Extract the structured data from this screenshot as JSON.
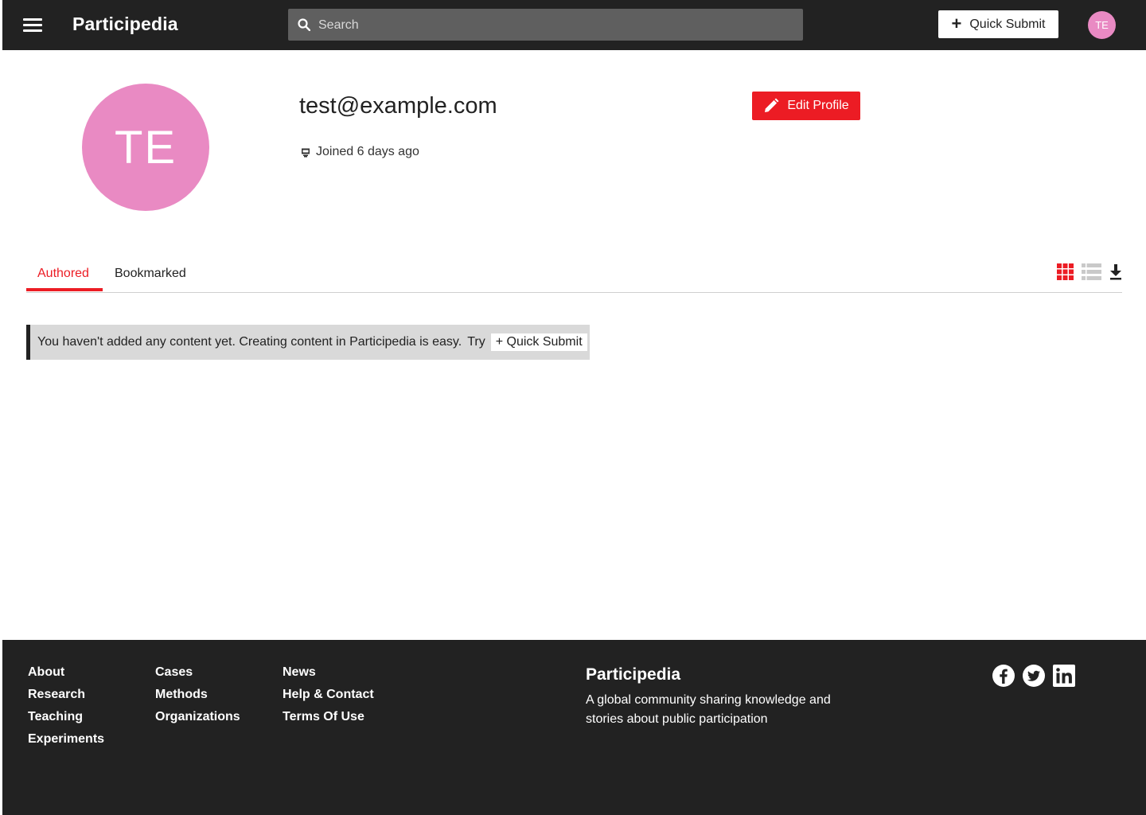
{
  "header": {
    "brand": "Participedia",
    "search_placeholder": "Search",
    "quick_submit": "Quick Submit",
    "avatar_initials": "TE"
  },
  "profile": {
    "avatar_initials": "TE",
    "email": "test@example.com",
    "joined": "Joined 6 days ago",
    "edit_button": "Edit Profile"
  },
  "tabs": {
    "items": [
      {
        "label": "Authored",
        "active": true
      },
      {
        "label": "Bookmarked",
        "active": false
      }
    ],
    "view_icons": [
      "grid-view-icon",
      "list-view-icon",
      "download-icon"
    ]
  },
  "notice": {
    "text": "You haven't added any content yet. Creating content in Participedia is easy.",
    "try": "Try",
    "quick_submit": "+ Quick Submit"
  },
  "footer": {
    "col1": [
      "About",
      "Research",
      "Teaching",
      "Experiments"
    ],
    "col2": [
      "Cases",
      "Methods",
      "Organizations"
    ],
    "col3": [
      "News",
      "Help & Contact",
      "Terms Of Use"
    ],
    "brand": "Participedia",
    "tagline": "A global community sharing knowledge and stories about public participation",
    "social": [
      "facebook-icon",
      "twitter-icon",
      "linkedin-icon"
    ]
  },
  "colors": {
    "accent": "#ec1c24",
    "header_bg": "#222222",
    "avatar": "#e98ac3",
    "notice_bg": "#d9d9d9"
  }
}
